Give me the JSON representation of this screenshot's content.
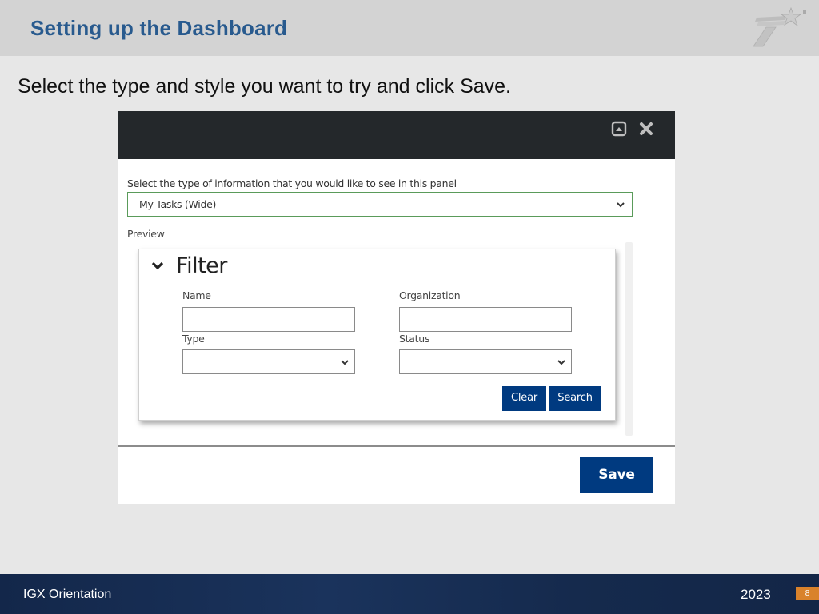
{
  "slide": {
    "title": "Setting up the Dashboard",
    "instruction": "Select the type and style you want to try and click Save.",
    "footer_left": "IGX Orientation",
    "footer_year": "2023",
    "page_number": "8"
  },
  "dialog": {
    "header_icons": [
      "restore-icon",
      "close-icon"
    ],
    "select_label": "Select the type of information that you would like to see in this panel",
    "selected_type": "My Tasks (Wide)",
    "preview_label": "Preview",
    "save_label": "Save",
    "filter": {
      "title": "Filter",
      "fields": {
        "name": {
          "label": "Name",
          "value": ""
        },
        "organization": {
          "label": "Organization",
          "value": ""
        },
        "type": {
          "label": "Type",
          "value": ""
        },
        "status": {
          "label": "Status",
          "value": ""
        }
      },
      "clear_label": "Clear",
      "search_label": "Search"
    }
  },
  "colors": {
    "title": "#285a8e",
    "primary_button": "#003a80",
    "dialog_header": "#24282b",
    "page_badge": "#d9822b",
    "footer": "#13274a"
  }
}
